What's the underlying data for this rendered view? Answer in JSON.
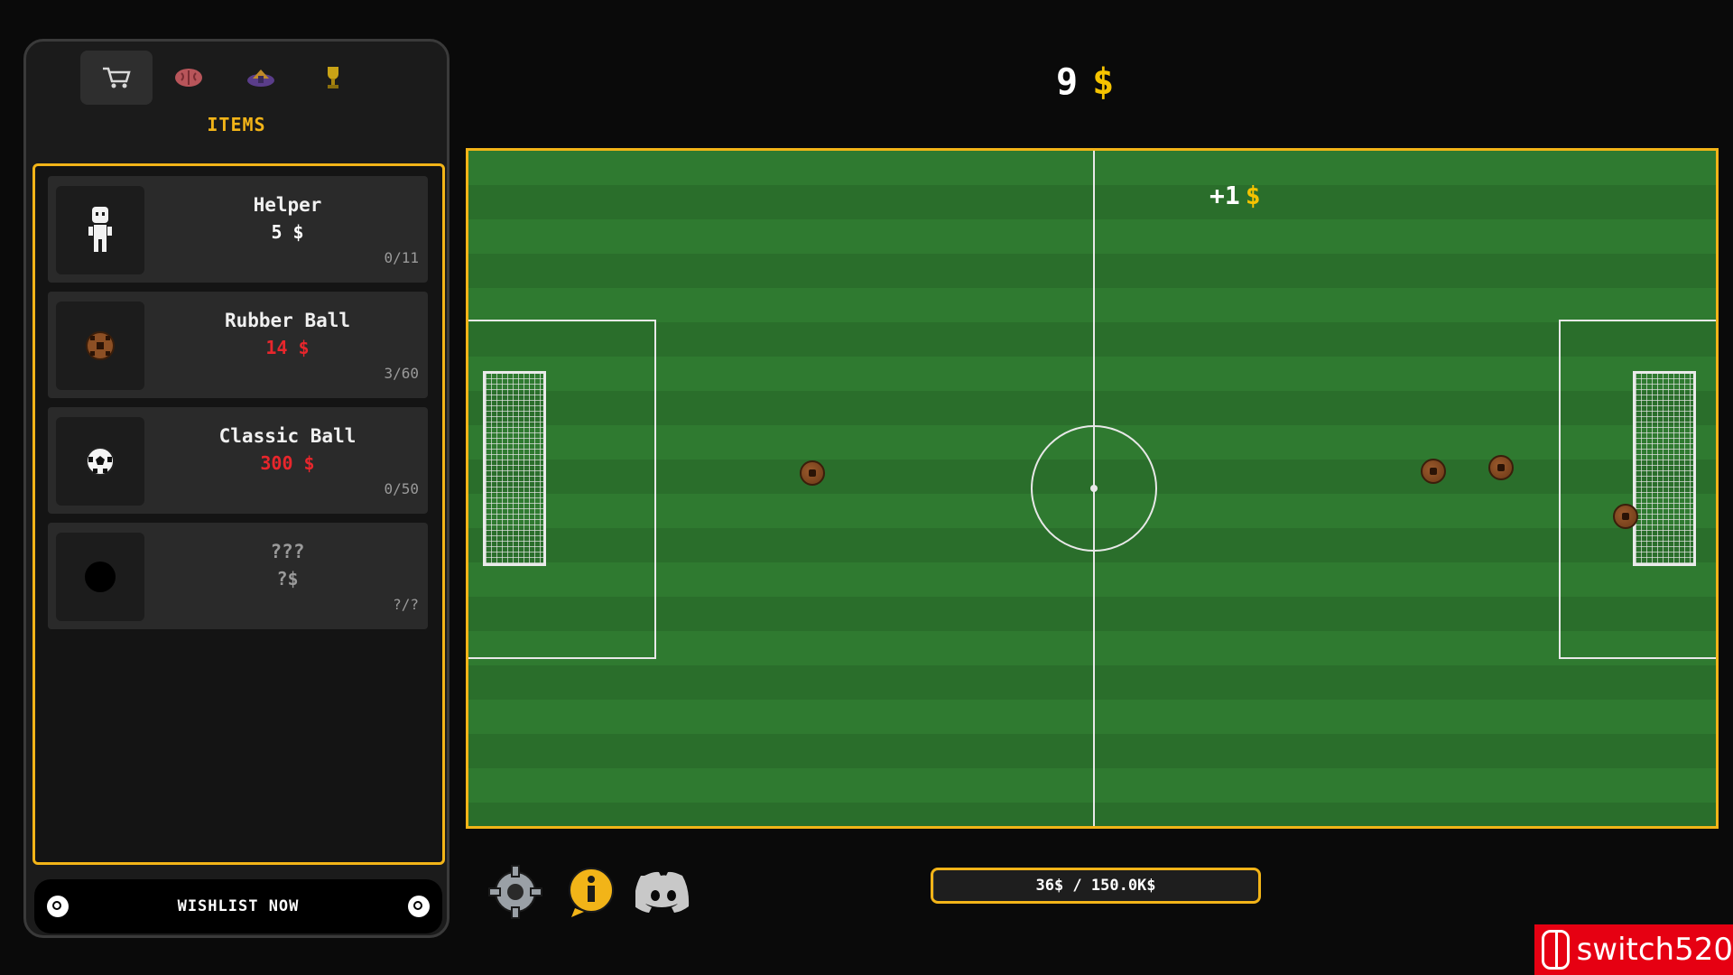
{
  "shop": {
    "tabs": [
      {
        "name": "shop-cart",
        "icon": "cart-icon",
        "active": true
      },
      {
        "name": "upgrades",
        "icon": "brain-icon",
        "active": false
      },
      {
        "name": "stadium",
        "icon": "stadium-icon",
        "active": false
      },
      {
        "name": "trophies",
        "icon": "trophy-icon",
        "active": false
      }
    ],
    "title": "ITEMS",
    "items": [
      {
        "name": "Helper",
        "price": "5 $",
        "count": "0/11",
        "affordable": true,
        "icon": "helper-icon"
      },
      {
        "name": "Rubber Ball",
        "price": "14 $",
        "count": "3/60",
        "affordable": false,
        "icon": "rubber-ball-icon"
      },
      {
        "name": "Classic Ball",
        "price": "300 $",
        "count": "0/50",
        "affordable": false,
        "icon": "classic-ball-icon"
      },
      {
        "name": "???",
        "price": "?$",
        "count": "?/?",
        "affordable": false,
        "icon": "locked-item-icon"
      }
    ],
    "wishlist_label": "WISHLIST NOW"
  },
  "header": {
    "money_value": "9",
    "currency": "$"
  },
  "field": {
    "gain_text": "+1",
    "gain_currency": "$"
  },
  "toolbar": {
    "settings_icon": "gear-icon",
    "info_icon": "info-icon",
    "discord_icon": "discord-icon",
    "progress_label": "36$ / 150.0K$",
    "progress_fraction": 0.00024
  },
  "watermark": {
    "text": "switch520"
  },
  "colors": {
    "accent": "#f2b418",
    "money": "#f5c300",
    "price_ok": "#ffffff",
    "price_blocked": "#e8262c",
    "pitch_light": "#2f7a30",
    "pitch_dark": "#2a6e2b",
    "watermark_red": "#e60012"
  }
}
